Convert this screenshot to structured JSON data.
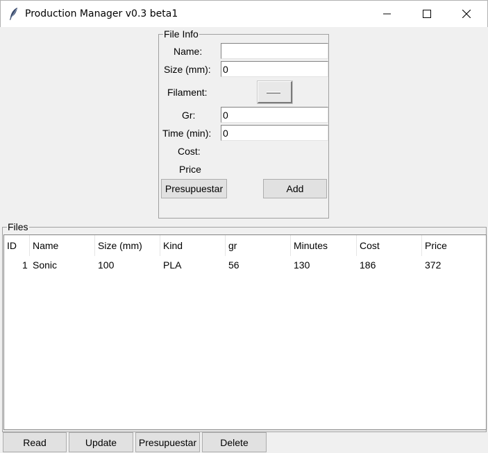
{
  "window": {
    "title": "Production Manager v0.3 beta1",
    "icon": "feather-icon"
  },
  "file_info": {
    "legend": "File Info",
    "name_label": "Name:",
    "name_value": "",
    "size_label": "Size (mm):",
    "size_value": "0",
    "filament_label": "Filament:",
    "filament_value": "",
    "gr_label": "Gr:",
    "gr_value": "0",
    "time_label": "Time (min):",
    "time_value": "0",
    "cost_label": "Cost:",
    "price_label": "Price",
    "presupuestar_button": "Presupuestar",
    "add_button": "Add"
  },
  "files": {
    "legend": "Files",
    "columns": [
      "ID",
      "Name",
      "Size (mm)",
      "Kind",
      "gr",
      "Minutes",
      "Cost",
      "Price"
    ],
    "rows": [
      [
        "1",
        "Sonic",
        "100",
        "PLA",
        "56",
        "130",
        "186",
        "372"
      ]
    ]
  },
  "toolbar": {
    "read_label": "Read",
    "update_label": "Update",
    "presupuestar_label": "Presupuestar",
    "delete_label": "Delete"
  }
}
